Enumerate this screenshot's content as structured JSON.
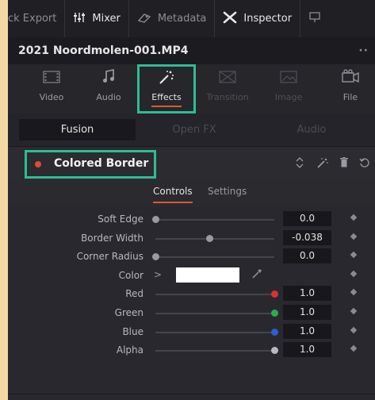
{
  "toolbar": {
    "items": [
      {
        "label": "ck Export",
        "icon": ""
      },
      {
        "label": "Mixer",
        "icon": "mixer-icon"
      },
      {
        "label": "Metadata",
        "icon": "metadata-icon"
      },
      {
        "label": "Inspector",
        "icon": "inspector-icon"
      }
    ]
  },
  "clip": {
    "name": "2021 Noordmolen-001.MP4",
    "more": "··"
  },
  "tabs": [
    {
      "label": "Video",
      "icon": "video-icon"
    },
    {
      "label": "Audio",
      "icon": "audio-icon"
    },
    {
      "label": "Effects",
      "icon": "effects-icon"
    },
    {
      "label": "Transition",
      "icon": "transition-icon"
    },
    {
      "label": "Image",
      "icon": "image-icon"
    },
    {
      "label": "File",
      "icon": "file-icon"
    }
  ],
  "subtabs": [
    "Fusion",
    "Open FX",
    "Audio"
  ],
  "effect": {
    "title": "Colored Border",
    "status_color": "#e24a33"
  },
  "control_tabs": {
    "controls": "Controls",
    "settings": "Settings"
  },
  "params": [
    {
      "label": "Soft Edge",
      "value": "0.0",
      "slider": 0.0,
      "knob_color": "#9a9aa0"
    },
    {
      "label": "Border Width",
      "value": "-0.038",
      "slider": 0.45,
      "knob_color": "#9a9aa0"
    },
    {
      "label": "Corner Radius",
      "value": "0.0",
      "slider": 0.0,
      "knob_color": "#9a9aa0"
    },
    {
      "label": "Color",
      "swatch": "#ffffff"
    },
    {
      "label": "Red",
      "value": "1.0",
      "slider": 1.0,
      "knob_color": "#e0302c"
    },
    {
      "label": "Green",
      "value": "1.0",
      "slider": 1.0,
      "knob_color": "#2eaa4a"
    },
    {
      "label": "Blue",
      "value": "1.0",
      "slider": 1.0,
      "knob_color": "#2a5fd0"
    },
    {
      "label": "Alpha",
      "value": "1.0",
      "slider": 1.0,
      "knob_color": "#b8b8bd"
    }
  ],
  "colors": {
    "accent": "#d45a3c",
    "highlight": "#2ebc96"
  }
}
